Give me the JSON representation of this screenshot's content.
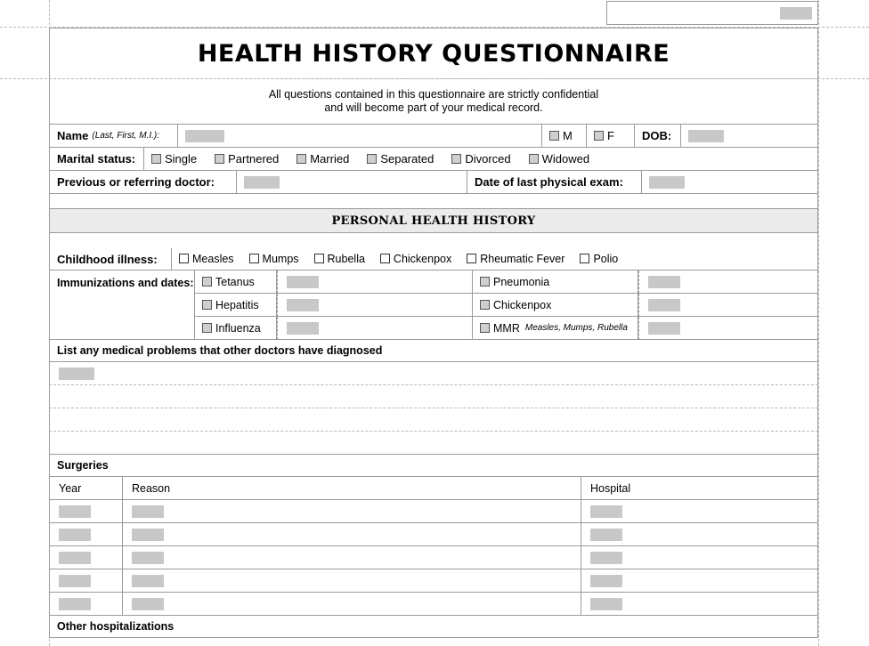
{
  "header": {
    "title": "HEALTH HISTORY QUESTIONNAIRE",
    "subtitle_line1": "All questions contained in this questionnaire are strictly confidential",
    "subtitle_line2": "and will become part of your medical record."
  },
  "identity": {
    "name_label": "Name",
    "name_hint": "(Last, First, M.I.):",
    "name_value": "",
    "sex_male_label": "M",
    "sex_female_label": "F",
    "dob_label": "DOB:",
    "dob_value": "",
    "marital_label": "Marital status:",
    "marital_options": [
      "Single",
      "Partnered",
      "Married",
      "Separated",
      "Divorced",
      "Widowed"
    ],
    "previous_doctor_label": "Previous or referring doctor:",
    "previous_doctor_value": "",
    "last_exam_label": "Date of last physical exam:",
    "last_exam_value": ""
  },
  "section": {
    "band_title": "PERSONAL HEALTH HISTORY"
  },
  "childhood": {
    "label": "Childhood illness:",
    "options": [
      "Measles",
      "Mumps",
      "Rubella",
      "Chickenpox",
      "Rheumatic Fever",
      "Polio"
    ]
  },
  "immunizations": {
    "label": "Immunizations and dates:",
    "left_column": [
      {
        "name": "Tetanus",
        "date": ""
      },
      {
        "name": "Hepatitis",
        "date": ""
      },
      {
        "name": "Influenza",
        "date": ""
      }
    ],
    "right_column": [
      {
        "name": "Pneumonia",
        "note": "",
        "date": ""
      },
      {
        "name": "Chickenpox",
        "note": "",
        "date": ""
      },
      {
        "name": "MMR",
        "note": "Measles, Mumps, Rubella",
        "date": ""
      }
    ]
  },
  "medical_problems": {
    "heading": "List any medical problems that other doctors have diagnosed",
    "rows": [
      "",
      "",
      "",
      ""
    ]
  },
  "surgeries": {
    "heading": "Surgeries",
    "columns": [
      "Year",
      "Reason",
      "Hospital"
    ],
    "rows": [
      {
        "year": "",
        "reason": "",
        "hospital": ""
      },
      {
        "year": "",
        "reason": "",
        "hospital": ""
      },
      {
        "year": "",
        "reason": "",
        "hospital": ""
      },
      {
        "year": "",
        "reason": "",
        "hospital": ""
      },
      {
        "year": "",
        "reason": "",
        "hospital": ""
      }
    ]
  },
  "other_hospitalizations": {
    "heading": "Other hospitalizations"
  },
  "colors": {
    "field_fill": "#c8c8c8",
    "band_background": "#ebebeb",
    "border": "#9a9a9a",
    "guide": "#b9b9b9"
  }
}
